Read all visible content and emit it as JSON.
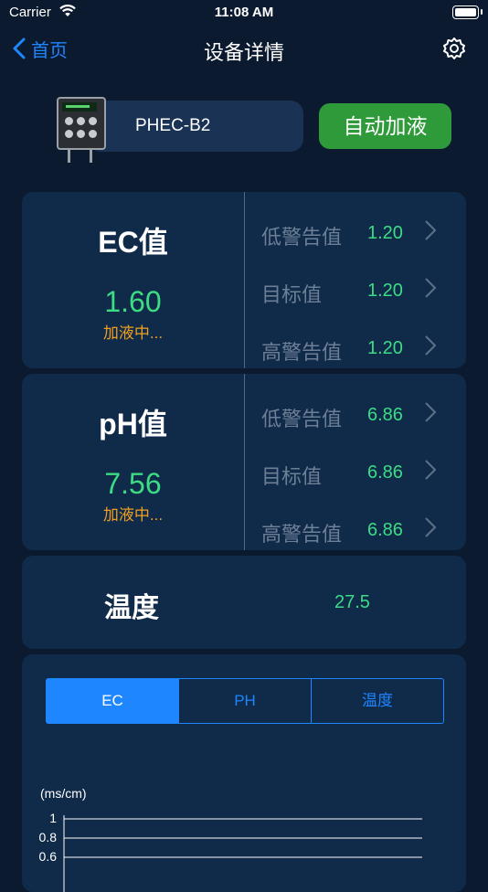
{
  "status_bar": {
    "carrier": "Carrier",
    "time": "11:08 AM"
  },
  "nav": {
    "back_label": "首页",
    "title": "设备详情"
  },
  "device": {
    "name": "PHEC-B2",
    "action_label": "自动加液"
  },
  "ec_card": {
    "title": "EC值",
    "value": "1.60",
    "status": "加液中...",
    "rows": [
      {
        "label": "低警告值",
        "value": "1.20"
      },
      {
        "label": "目标值",
        "value": "1.20"
      },
      {
        "label": "高警告值",
        "value": "1.20"
      }
    ]
  },
  "ph_card": {
    "title": "pH值",
    "value": "7.56",
    "status": "加液中...",
    "rows": [
      {
        "label": "低警告值",
        "value": "6.86"
      },
      {
        "label": "目标值",
        "value": "6.86"
      },
      {
        "label": "高警告值",
        "value": "6.86"
      }
    ]
  },
  "temp_card": {
    "title": "温度",
    "value": "27.5"
  },
  "chart_tabs": [
    {
      "label": "EC",
      "active": true
    },
    {
      "label": "PH",
      "active": false
    },
    {
      "label": "温度",
      "active": false
    }
  ],
  "chart_data": {
    "type": "line",
    "ylabel": "(ms/cm)",
    "yticks": [
      "1",
      "0.8",
      "0.6"
    ],
    "series": []
  },
  "colors": {
    "accent": "#1e86ff",
    "value_green": "#3ddc84",
    "status_orange": "#f0a020",
    "button_green": "#2e9a3a"
  }
}
